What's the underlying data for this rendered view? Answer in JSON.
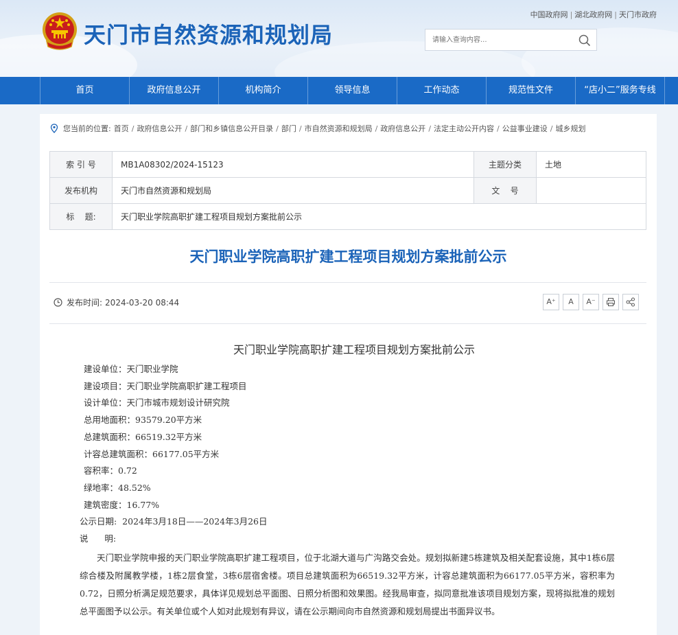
{
  "header": {
    "site_title": "天门市自然资源和规划局",
    "top_links": [
      "中国政府网",
      "湖北政府网",
      "天门市政府"
    ],
    "search_placeholder": "请输入查询内容...",
    "emblem_icon": "national-emblem-icon"
  },
  "nav": {
    "items": [
      "首页",
      "政府信息公开",
      "机构简介",
      "领导信息",
      "工作动态",
      "规范性文件",
      "“店小二”服务专线"
    ]
  },
  "breadcrumb": {
    "prefix": "您当前的位置:",
    "items": [
      "首页",
      "政府信息公开",
      "部门和乡镇信息公开目录",
      "部门",
      "市自然资源和规划局",
      "政府信息公开",
      "法定主动公开内容",
      "公益事业建设",
      "城乡规划"
    ]
  },
  "meta": {
    "index_label": "索 引 号",
    "index_value": "MB1A08302/2024-15123",
    "category_label": "主题分类",
    "category_value": "土地",
    "org_label": "发布机构",
    "org_value": "天门市自然资源和规划局",
    "docno_label": "文    号",
    "docno_value": "",
    "title_label": "标    题:",
    "title_value": "天门职业学院高职扩建工程项目规划方案批前公示"
  },
  "article": {
    "title": "天门职业学院高职扩建工程项目规划方案批前公示",
    "pubtime_label": "发布时间:",
    "pubtime_value": "2024-03-20 08:44",
    "tools": [
      "A⁺",
      "A",
      "A⁻",
      "print-icon",
      "share-icon"
    ]
  },
  "content": {
    "title": "天门职业学院高职扩建工程项目规划方案批前公示",
    "fields": [
      "建设单位：天门职业学院",
      "建设项目：天门职业学院高职扩建工程项目",
      "设计单位：天门市城市规划设计研究院",
      "总用地面积：93579.20平方米",
      "总建筑面积：66519.32平方米",
      "计容总建筑面积：66177.05平方米",
      "容积率：0.72",
      "绿地率：48.52%",
      "建筑密度：16.77%"
    ],
    "notice_date": "公示日期:  2024年3月18日——2024年3月26日",
    "explain_label": "说      明:",
    "paragraph": "天门职业学院申报的天门职业学院高职扩建工程项目，位于北湖大道与广沟路交会处。规划拟新建5栋建筑及相关配套设施，其中1栋6层综合楼及附属教学楼，1栋2层食堂，3栋6层宿舍楼。项目总建筑面积为66519.32平方米，计容总建筑面积为66177.05平方米，容积率为0.72，日照分析满足规范要求，具体详见规划总平面图、日照分析图和效果图。经我局审查，拟同意批准该项目规划方案，现将拟批准的规划总平面图予以公示。有关单位或个人如对此规划有异议，请在公示期间向市自然资源和规划局提出书面异议书。"
  }
}
